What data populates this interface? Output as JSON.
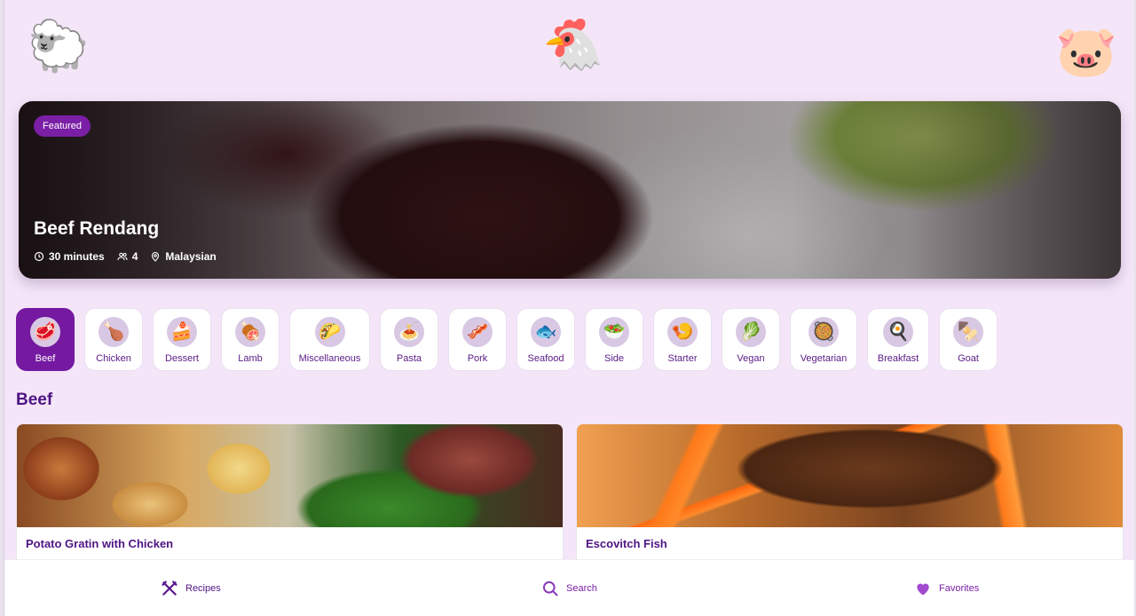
{
  "mascots": {
    "left": "🐑",
    "center": "🐔",
    "right": "🐷"
  },
  "featured": {
    "badge": "Featured",
    "title": "Beef Rendang",
    "time": "30 minutes",
    "servings": "4",
    "cuisine": "Malaysian"
  },
  "categories": [
    {
      "label": "Beef",
      "icon": "🥩",
      "active": true
    },
    {
      "label": "Chicken",
      "icon": "🍗"
    },
    {
      "label": "Dessert",
      "icon": "🍰"
    },
    {
      "label": "Lamb",
      "icon": "🍖"
    },
    {
      "label": "Miscellaneous",
      "icon": "🌮"
    },
    {
      "label": "Pasta",
      "icon": "🍝"
    },
    {
      "label": "Pork",
      "icon": "🥓"
    },
    {
      "label": "Seafood",
      "icon": "🐟"
    },
    {
      "label": "Side",
      "icon": "🥗"
    },
    {
      "label": "Starter",
      "icon": "🍤"
    },
    {
      "label": "Vegan",
      "icon": "🥬"
    },
    {
      "label": "Vegetarian",
      "icon": "🥘"
    },
    {
      "label": "Breakfast",
      "icon": "🍳"
    },
    {
      "label": "Goat",
      "icon": "🍢"
    }
  ],
  "section": {
    "title": "Beef"
  },
  "cards": [
    {
      "title": "Potato Gratin with Chicken",
      "description": "..."
    },
    {
      "title": "Escovitch Fish",
      "description": "..."
    }
  ],
  "nav": {
    "recipes": "Recipes",
    "search": "Search",
    "favorites": "Favorites"
  },
  "colors": {
    "accent": "#7419a0",
    "title": "#4e1483",
    "background": "#f4e6f8"
  }
}
